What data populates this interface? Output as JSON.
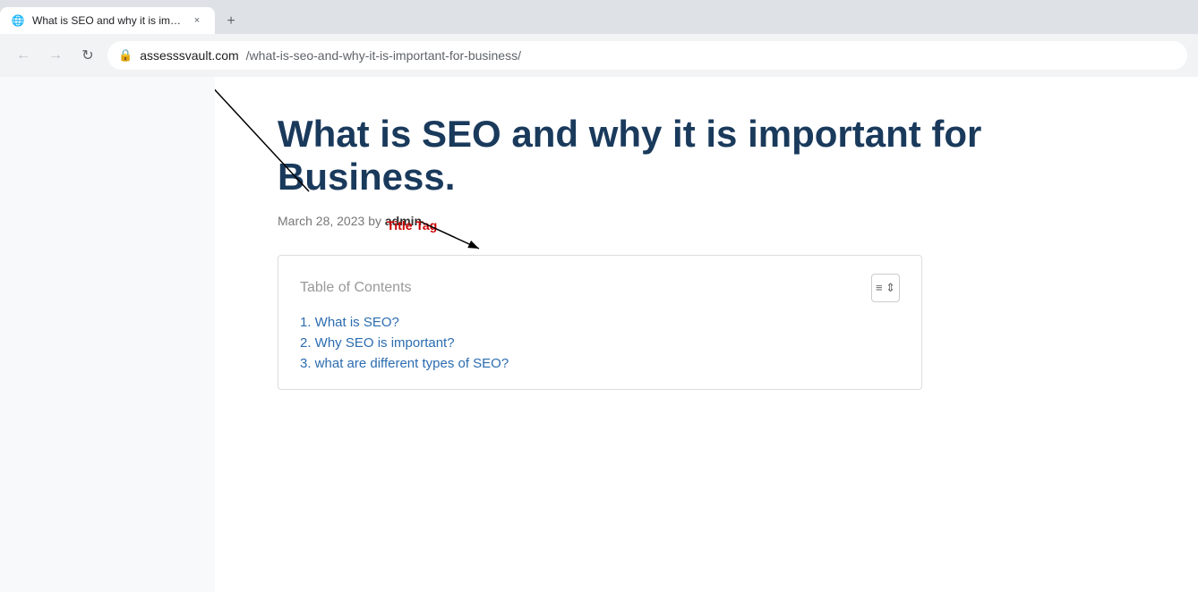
{
  "browser": {
    "tab": {
      "favicon": "🌐",
      "title": "What is SEO and why it is import...",
      "close_label": "×"
    },
    "new_tab_label": "+",
    "nav": {
      "back_label": "←",
      "forward_label": "→",
      "reload_label": "↻",
      "lock_icon": "🔒",
      "url_domain": "assesssvault.com",
      "url_path": "/what-is-seo-and-why-it-is-important-for-business/"
    }
  },
  "annotation": {
    "title_tag_label": "Title Tag"
  },
  "article": {
    "title": "What is SEO and why it is important for Business.",
    "date": "March 28, 2023",
    "by": "by",
    "author": "admin",
    "toc": {
      "title": "Table of Contents",
      "items": [
        "1. What is SEO?",
        "2. Why SEO is important?",
        "3. what are different types of SEO?"
      ]
    }
  }
}
